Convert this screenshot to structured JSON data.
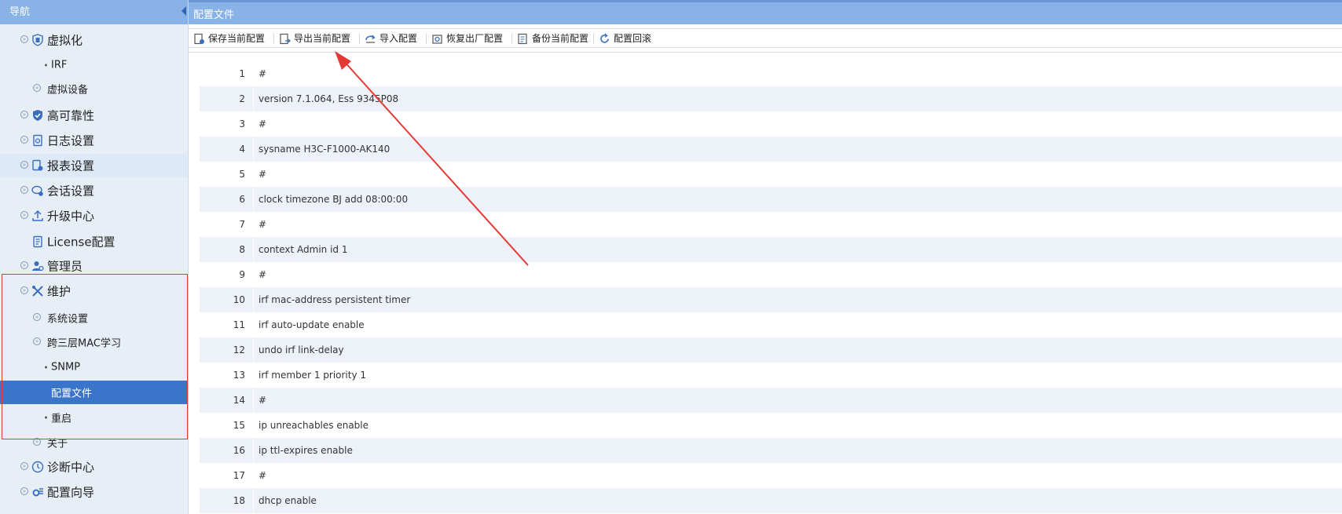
{
  "sidebar": {
    "title": "导航",
    "items": [
      {
        "label": "虚拟化"
      },
      {
        "label": "IRF"
      },
      {
        "label": "虚拟设备"
      },
      {
        "label": "高可靠性"
      },
      {
        "label": "日志设置"
      },
      {
        "label": "报表设置"
      },
      {
        "label": "会话设置"
      },
      {
        "label": "升级中心"
      },
      {
        "label": "License配置"
      },
      {
        "label": "管理员"
      },
      {
        "label": "维护"
      },
      {
        "label": "系统设置"
      },
      {
        "label": "跨三层MAC学习"
      },
      {
        "label": "SNMP"
      },
      {
        "label": "配置文件"
      },
      {
        "label": "重启"
      },
      {
        "label": "关于"
      },
      {
        "label": "诊断中心"
      },
      {
        "label": "配置向导"
      }
    ]
  },
  "main": {
    "tab_title": "配置文件",
    "toolbar": {
      "save": "保存当前配置",
      "export": "导出当前配置",
      "import": "导入配置",
      "restore": "恢复出厂配置",
      "backup": "备份当前配置",
      "rollback": "配置回滚"
    },
    "lines": [
      {
        "n": "1",
        "text": "#"
      },
      {
        "n": "2",
        "text": "version 7.1.064, Ess 9345P08"
      },
      {
        "n": "3",
        "text": "#"
      },
      {
        "n": "4",
        "text": "sysname H3C-F1000-AK140"
      },
      {
        "n": "5",
        "text": "#"
      },
      {
        "n": "6",
        "text": "clock timezone BJ add 08:00:00"
      },
      {
        "n": "7",
        "text": "#"
      },
      {
        "n": "8",
        "text": "context Admin id 1"
      },
      {
        "n": "9",
        "text": "#"
      },
      {
        "n": "10",
        "text": "irf mac-address persistent timer"
      },
      {
        "n": "11",
        "text": "irf auto-update enable"
      },
      {
        "n": "12",
        "text": "undo irf link-delay"
      },
      {
        "n": "13",
        "text": "irf member 1 priority 1"
      },
      {
        "n": "14",
        "text": "#"
      },
      {
        "n": "15",
        "text": "ip unreachables enable"
      },
      {
        "n": "16",
        "text": "ip ttl-expires enable"
      },
      {
        "n": "17",
        "text": "#"
      },
      {
        "n": "18",
        "text": "dhcp enable"
      }
    ]
  },
  "colors": {
    "header_blue": "#89b2e6",
    "selected_blue": "#3a75c9",
    "annotation_red": "#e53935"
  }
}
